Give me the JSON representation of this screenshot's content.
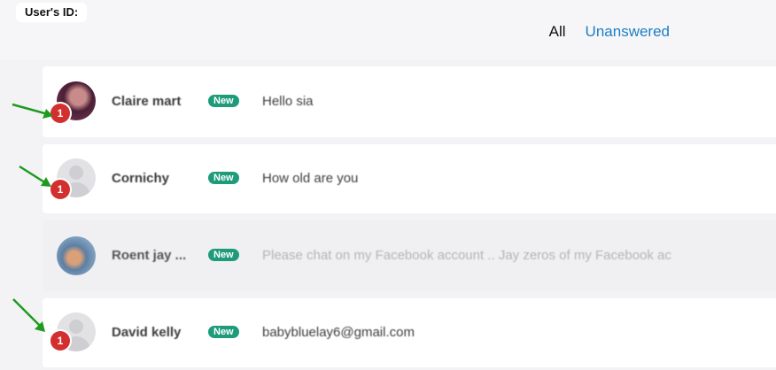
{
  "header": {
    "user_id_label": "User's ID:",
    "tabs": [
      {
        "label": "All"
      },
      {
        "label": "Unanswered"
      }
    ]
  },
  "conversations": [
    {
      "name": "Claire mart",
      "badge": "New",
      "message": "Hello sia",
      "unread": "1",
      "avatar": "photo"
    },
    {
      "name": "Cornichy",
      "badge": "New",
      "message": "How old are you",
      "unread": "1",
      "avatar": "placeholder-person-icon"
    },
    {
      "name": "Roent jay ...",
      "badge": "New",
      "message": "Please chat on my Facebook account .. Jay zeros of my Facebook ac",
      "unread": "",
      "avatar": "photo"
    },
    {
      "name": "David kelly",
      "badge": "New",
      "message": "babybluelay6@gmail.com",
      "unread": "1",
      "avatar": "placeholder-person-icon"
    }
  ],
  "colors": {
    "accent_tab": "#1d7fc2",
    "new_badge": "#1e9b7b",
    "unread_badge": "#d32f2f",
    "annotation_arrow": "#1f9a1f"
  }
}
